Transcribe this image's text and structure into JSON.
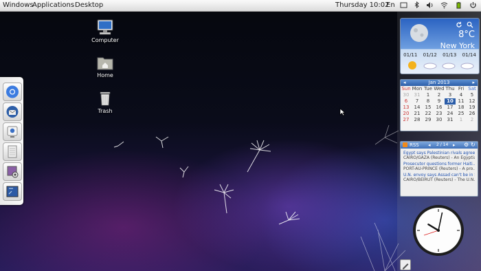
{
  "panel": {
    "menus": [
      "Windows",
      "Applications",
      "Desktop"
    ],
    "clock": "Thursday 10:02",
    "language": "En",
    "tray_icons": [
      "screen-icon",
      "bluetooth-icon",
      "volume-icon",
      "wifi-icon",
      "battery-icon",
      "power-icon"
    ]
  },
  "desktop_icons": [
    {
      "label": "Computer",
      "icon": "computer-icon"
    },
    {
      "label": "Home",
      "icon": "home-folder-icon"
    },
    {
      "label": "Trash",
      "icon": "trash-icon"
    }
  ],
  "dock": {
    "items": [
      "chrome-icon",
      "thunderbird-icon",
      "webcam-icon",
      "file-manager-icon",
      "settings-icon",
      "terminal-icon"
    ]
  },
  "weather": {
    "temperature": "8°C",
    "city": "New York",
    "forecast": [
      {
        "date": "01/11",
        "icon": "sun-icon"
      },
      {
        "date": "01/12",
        "icon": "cloud-icon"
      },
      {
        "date": "01/13",
        "icon": "cloud-icon"
      },
      {
        "date": "01/14",
        "icon": "cloud-icon"
      }
    ]
  },
  "calendar": {
    "month": "Jan 2013",
    "weekdays": [
      "Sun",
      "Mon",
      "Tue",
      "Wed",
      "Thu",
      "Fri",
      "Sat"
    ],
    "weeks": [
      [
        "30",
        "31",
        "1",
        "2",
        "3",
        "4",
        "5"
      ],
      [
        "6",
        "7",
        "8",
        "9",
        "10",
        "11",
        "12"
      ],
      [
        "13",
        "14",
        "15",
        "16",
        "17",
        "18",
        "19"
      ],
      [
        "20",
        "21",
        "22",
        "23",
        "24",
        "25",
        "26"
      ],
      [
        "27",
        "28",
        "29",
        "30",
        "31",
        "1",
        "2"
      ]
    ],
    "today": "10"
  },
  "rss": {
    "title": "RSS",
    "page": "2 / 14",
    "items": [
      {
        "headline": "Egypt says Palestinian rivals agree t...",
        "summary": "CAIRO/GAZA (Reuters) - An Egyptia..."
      },
      {
        "headline": "Prosecutor questions former Haiti...",
        "summary": "PORT-AU-PRINCE (Reuters) - A pro..."
      },
      {
        "headline": "U.N. envoy says Assad can't be in S...",
        "summary": "CAIRO/BEIRUT (Reuters) - The U.N..."
      }
    ]
  },
  "clock_widget": {
    "hour": 10,
    "minute": 2
  }
}
